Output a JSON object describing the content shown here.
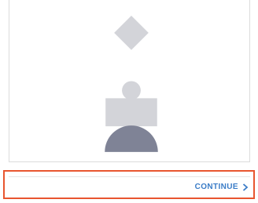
{
  "footer": {
    "continue_label": "CONTINUE",
    "continue_icon": "chevron-right-icon",
    "accent_color": "#3b7cc7",
    "highlight_color": "#e8552f"
  },
  "illustration": {
    "icon": "shapes-illustration",
    "shape_colors": {
      "light": "#d3d4d9",
      "dark": "#7f8396"
    }
  }
}
